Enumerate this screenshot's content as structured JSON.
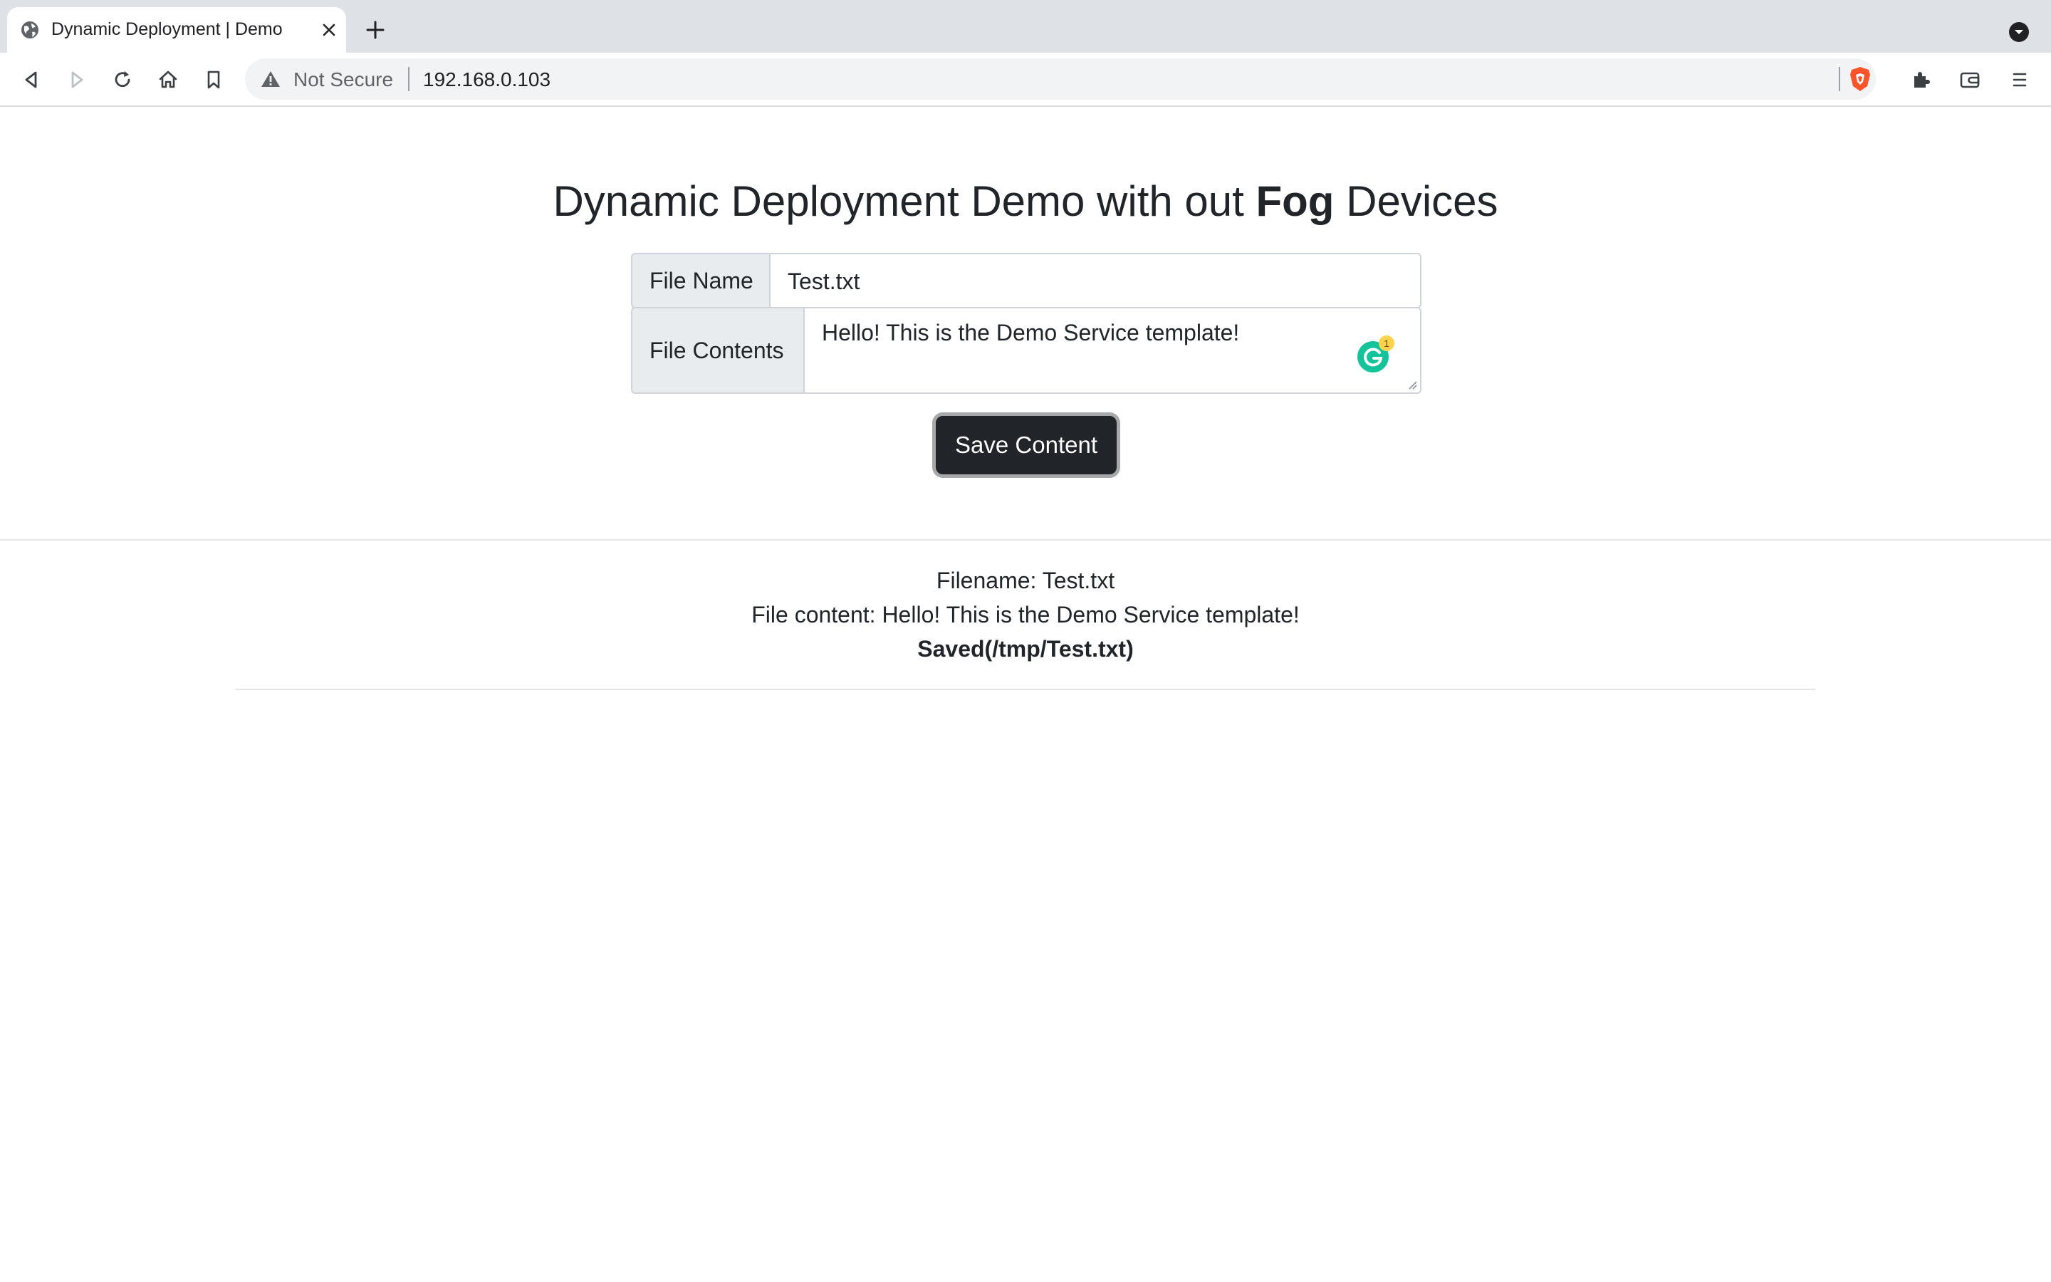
{
  "browser": {
    "tab": {
      "title": "Dynamic Deployment | Demo",
      "favicon": "globe-icon"
    },
    "omnibox": {
      "security_label": "Not Secure",
      "url": "192.168.0.103"
    },
    "toolbar_icons": [
      "back-icon",
      "forward-icon",
      "reload-icon",
      "home-icon",
      "bookmark-icon",
      "extensions-icon",
      "wallet-icon",
      "menu-icon"
    ]
  },
  "page": {
    "title_prefix": "Dynamic Deployment Demo with out ",
    "title_bold": "Fog",
    "title_suffix": " Devices",
    "form": {
      "file_name_label": "File Name",
      "file_name_value": "Test.txt",
      "file_contents_label": "File Contents",
      "file_contents_value": "Hello! This is the Demo Service template!",
      "grammarly_badge": "1",
      "save_label": "Save Content"
    },
    "result": {
      "filename_line": "Filename: Test.txt",
      "content_line": "File content: Hello! This is the Demo Service template!",
      "saved_line": "Saved(/tmp/Test.txt)"
    }
  },
  "colors": {
    "button_bg": "#212529",
    "grammarly": "#15c39a",
    "brave": "#fb542b"
  }
}
